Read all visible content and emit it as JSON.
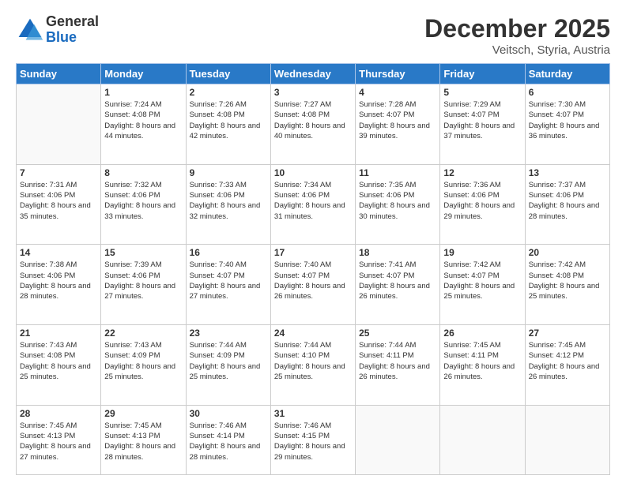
{
  "logo": {
    "general": "General",
    "blue": "Blue"
  },
  "header": {
    "month": "December 2025",
    "location": "Veitsch, Styria, Austria"
  },
  "weekdays": [
    "Sunday",
    "Monday",
    "Tuesday",
    "Wednesday",
    "Thursday",
    "Friday",
    "Saturday"
  ],
  "days": [
    {
      "date": "",
      "info": ""
    },
    {
      "date": "1",
      "sunrise": "7:24 AM",
      "sunset": "4:08 PM",
      "daylight": "8 hours and 44 minutes."
    },
    {
      "date": "2",
      "sunrise": "7:26 AM",
      "sunset": "4:08 PM",
      "daylight": "8 hours and 42 minutes."
    },
    {
      "date": "3",
      "sunrise": "7:27 AM",
      "sunset": "4:08 PM",
      "daylight": "8 hours and 40 minutes."
    },
    {
      "date": "4",
      "sunrise": "7:28 AM",
      "sunset": "4:07 PM",
      "daylight": "8 hours and 39 minutes."
    },
    {
      "date": "5",
      "sunrise": "7:29 AM",
      "sunset": "4:07 PM",
      "daylight": "8 hours and 37 minutes."
    },
    {
      "date": "6",
      "sunrise": "7:30 AM",
      "sunset": "4:07 PM",
      "daylight": "8 hours and 36 minutes."
    },
    {
      "date": "7",
      "sunrise": "7:31 AM",
      "sunset": "4:06 PM",
      "daylight": "8 hours and 35 minutes."
    },
    {
      "date": "8",
      "sunrise": "7:32 AM",
      "sunset": "4:06 PM",
      "daylight": "8 hours and 33 minutes."
    },
    {
      "date": "9",
      "sunrise": "7:33 AM",
      "sunset": "4:06 PM",
      "daylight": "8 hours and 32 minutes."
    },
    {
      "date": "10",
      "sunrise": "7:34 AM",
      "sunset": "4:06 PM",
      "daylight": "8 hours and 31 minutes."
    },
    {
      "date": "11",
      "sunrise": "7:35 AM",
      "sunset": "4:06 PM",
      "daylight": "8 hours and 30 minutes."
    },
    {
      "date": "12",
      "sunrise": "7:36 AM",
      "sunset": "4:06 PM",
      "daylight": "8 hours and 29 minutes."
    },
    {
      "date": "13",
      "sunrise": "7:37 AM",
      "sunset": "4:06 PM",
      "daylight": "8 hours and 28 minutes."
    },
    {
      "date": "14",
      "sunrise": "7:38 AM",
      "sunset": "4:06 PM",
      "daylight": "8 hours and 28 minutes."
    },
    {
      "date": "15",
      "sunrise": "7:39 AM",
      "sunset": "4:06 PM",
      "daylight": "8 hours and 27 minutes."
    },
    {
      "date": "16",
      "sunrise": "7:40 AM",
      "sunset": "4:07 PM",
      "daylight": "8 hours and 27 minutes."
    },
    {
      "date": "17",
      "sunrise": "7:40 AM",
      "sunset": "4:07 PM",
      "daylight": "8 hours and 26 minutes."
    },
    {
      "date": "18",
      "sunrise": "7:41 AM",
      "sunset": "4:07 PM",
      "daylight": "8 hours and 26 minutes."
    },
    {
      "date": "19",
      "sunrise": "7:42 AM",
      "sunset": "4:07 PM",
      "daylight": "8 hours and 25 minutes."
    },
    {
      "date": "20",
      "sunrise": "7:42 AM",
      "sunset": "4:08 PM",
      "daylight": "8 hours and 25 minutes."
    },
    {
      "date": "21",
      "sunrise": "7:43 AM",
      "sunset": "4:08 PM",
      "daylight": "8 hours and 25 minutes."
    },
    {
      "date": "22",
      "sunrise": "7:43 AM",
      "sunset": "4:09 PM",
      "daylight": "8 hours and 25 minutes."
    },
    {
      "date": "23",
      "sunrise": "7:44 AM",
      "sunset": "4:09 PM",
      "daylight": "8 hours and 25 minutes."
    },
    {
      "date": "24",
      "sunrise": "7:44 AM",
      "sunset": "4:10 PM",
      "daylight": "8 hours and 25 minutes."
    },
    {
      "date": "25",
      "sunrise": "7:44 AM",
      "sunset": "4:11 PM",
      "daylight": "8 hours and 26 minutes."
    },
    {
      "date": "26",
      "sunrise": "7:45 AM",
      "sunset": "4:11 PM",
      "daylight": "8 hours and 26 minutes."
    },
    {
      "date": "27",
      "sunrise": "7:45 AM",
      "sunset": "4:12 PM",
      "daylight": "8 hours and 26 minutes."
    },
    {
      "date": "28",
      "sunrise": "7:45 AM",
      "sunset": "4:13 PM",
      "daylight": "8 hours and 27 minutes."
    },
    {
      "date": "29",
      "sunrise": "7:45 AM",
      "sunset": "4:13 PM",
      "daylight": "8 hours and 28 minutes."
    },
    {
      "date": "30",
      "sunrise": "7:46 AM",
      "sunset": "4:14 PM",
      "daylight": "8 hours and 28 minutes."
    },
    {
      "date": "31",
      "sunrise": "7:46 AM",
      "sunset": "4:15 PM",
      "daylight": "8 hours and 29 minutes."
    }
  ]
}
